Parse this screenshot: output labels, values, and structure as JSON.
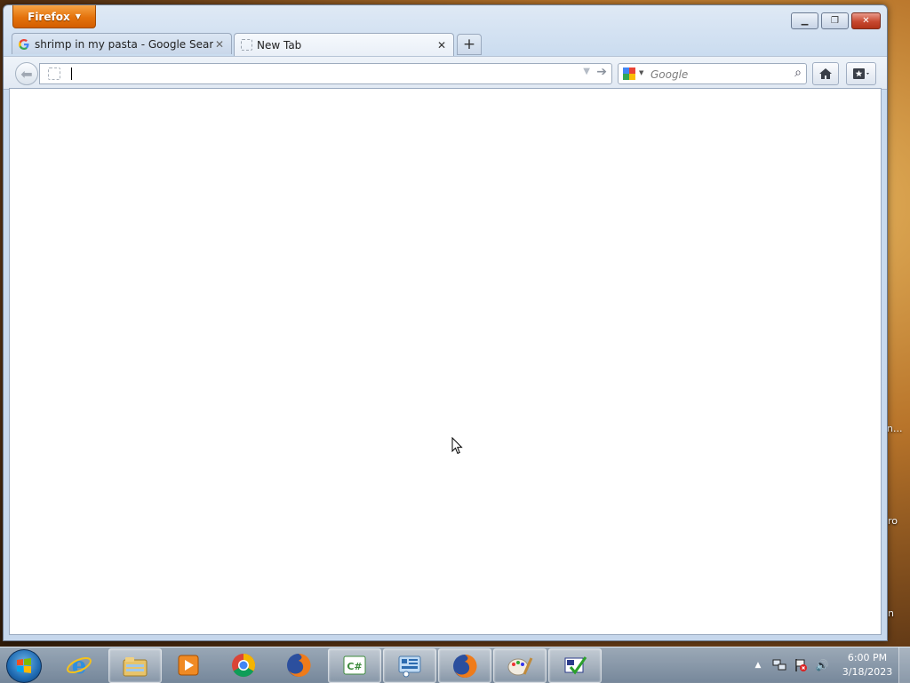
{
  "app": {
    "menu_button_label": "Firefox"
  },
  "tabs": [
    {
      "title": "shrimp in my pasta - Google Search",
      "favicon": "google-g-icon",
      "active": false
    },
    {
      "title": "New Tab",
      "favicon": "blank-page-icon",
      "active": true
    }
  ],
  "navbar": {
    "url_value": "",
    "search_placeholder": "Google"
  },
  "desktop": {
    "edge_labels": [
      "n...",
      "ro",
      "n"
    ]
  },
  "taskbar": {
    "items": [
      {
        "name": "internet-explorer-icon"
      },
      {
        "name": "windows-explorer-icon"
      },
      {
        "name": "media-player-icon"
      },
      {
        "name": "chrome-icon"
      },
      {
        "name": "firefox-icon"
      },
      {
        "name": "csharp-icon"
      },
      {
        "name": "control-panel-icon"
      },
      {
        "name": "firefox-icon",
        "active": true
      },
      {
        "name": "paint-icon"
      },
      {
        "name": "tasks-icon"
      }
    ],
    "clock": {
      "time": "6:00 PM",
      "date": "3/18/2023"
    }
  },
  "colors": {
    "firefox_orange": "#e4720c",
    "close_red": "#c7482f",
    "accent_blue": "#1f6bb3"
  }
}
